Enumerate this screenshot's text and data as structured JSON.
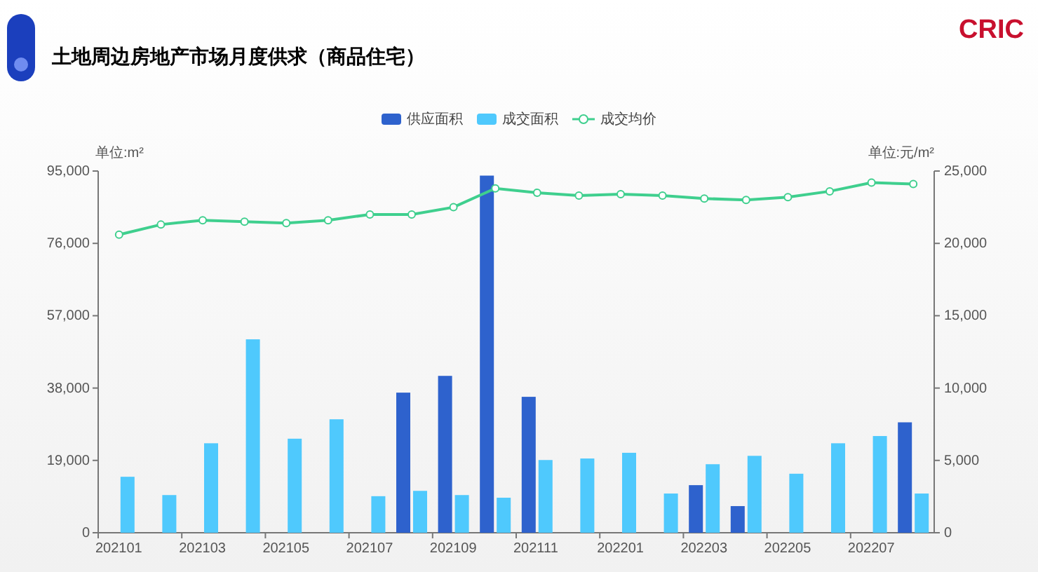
{
  "header": {
    "title": "土地周边房地产市场月度供求（商品住宅）",
    "logo": "CRIC"
  },
  "chart_data": {
    "type": "bar",
    "stacked": false,
    "ylabel": "单位:m²",
    "y2label": "单位:元/m²",
    "categories": [
      "202101",
      null,
      "202103",
      null,
      "202105",
      null,
      "202107",
      null,
      "202109",
      null,
      "202111",
      null,
      "202201",
      null,
      "202203",
      null,
      "202205",
      null,
      "202207",
      null
    ],
    "ylim": [
      0,
      95000
    ],
    "yticks": [
      {
        "value": 0,
        "label": "0"
      },
      {
        "value": 19000,
        "label": "19,000"
      },
      {
        "value": 38000,
        "label": "38,000"
      },
      {
        "value": 57000,
        "label": "57,000"
      },
      {
        "value": 76000,
        "label": "76,000"
      },
      {
        "value": 95000,
        "label": "95,000"
      }
    ],
    "y2lim": [
      0,
      25000
    ],
    "y2ticks": [
      {
        "value": 0,
        "label": "0"
      },
      {
        "value": 5000,
        "label": "5,000"
      },
      {
        "value": 10000,
        "label": "10,000"
      },
      {
        "value": 15000,
        "label": "15,000"
      },
      {
        "value": 20000,
        "label": "20,000"
      },
      {
        "value": 25000,
        "label": "25,000"
      }
    ],
    "series": [
      {
        "name": "供应面积",
        "color": "#2e62cd",
        "values": [
          null,
          null,
          null,
          null,
          null,
          null,
          null,
          36800,
          41200,
          93800,
          35700,
          null,
          null,
          null,
          12500,
          7000,
          null,
          null,
          null,
          29000
        ]
      },
      {
        "name": "成交面积",
        "color": "#4fc9fd",
        "values": [
          14700,
          9900,
          23500,
          50800,
          24700,
          29800,
          9600,
          11000,
          9900,
          9200,
          19100,
          19500,
          21000,
          10300,
          18000,
          20200,
          15500,
          23500,
          25400,
          10300
        ]
      },
      {
        "name": "成交均价",
        "type": "line",
        "marker": true,
        "axis": "y2",
        "color": "#3fcf8e",
        "values": [
          20600,
          21300,
          21600,
          21500,
          21400,
          21600,
          22000,
          22000,
          22500,
          23800,
          23500,
          23300,
          23400,
          23300,
          23100,
          23000,
          23200,
          23600,
          24200,
          24100
        ]
      }
    ]
  }
}
